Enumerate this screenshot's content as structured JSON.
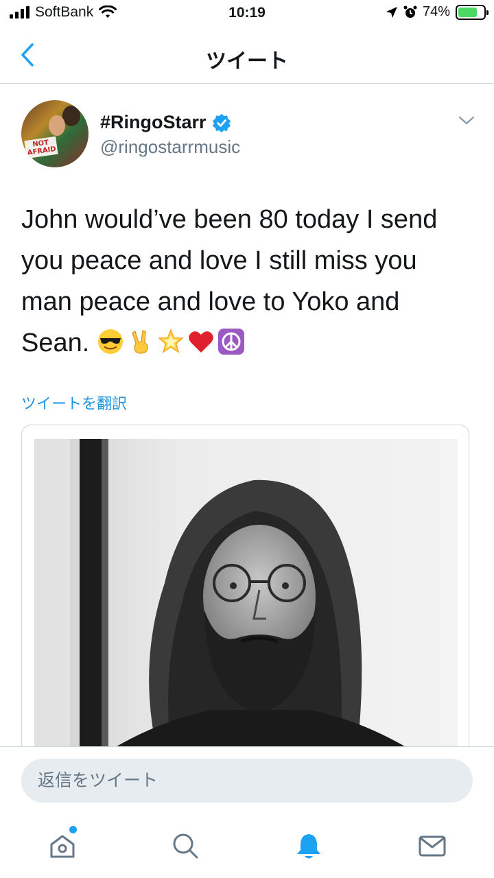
{
  "status_bar": {
    "carrier": "SoftBank",
    "time": "10:19",
    "battery_percent": "74%",
    "battery_level": 0.74,
    "icons": [
      "signal-icon",
      "wifi-icon",
      "location-icon",
      "alarm-icon",
      "battery-charging-icon"
    ]
  },
  "header": {
    "title": "ツイート",
    "back_icon": "chevron-left-icon"
  },
  "tweet": {
    "display_name": "#RingoStarr",
    "handle": "@ringostarrmusic",
    "avatar_sign_text": "NOT AFRAID",
    "verified_icon": "verified-badge-icon",
    "menu_icon": "chevron-down-icon",
    "text": "John would’ve been 80 today I send you peace and love I still miss you man peace and love to Yoko and Sean.",
    "emojis": [
      "smiling-face-with-sunglasses",
      "victory-hand",
      "glowing-star",
      "red-heart",
      "peace-symbol"
    ],
    "translate_link": "ツイートを翻訳"
  },
  "reply": {
    "placeholder": "返信をツイート"
  },
  "tab_bar": {
    "items": [
      "home-icon",
      "search-icon",
      "notifications-icon",
      "messages-icon"
    ],
    "active": "notifications-icon",
    "home_has_new": true
  },
  "colors": {
    "accent": "#1da1f2",
    "link": "#1b95e0",
    "secondary_text": "#657786",
    "divider": "#ccd6dd"
  }
}
